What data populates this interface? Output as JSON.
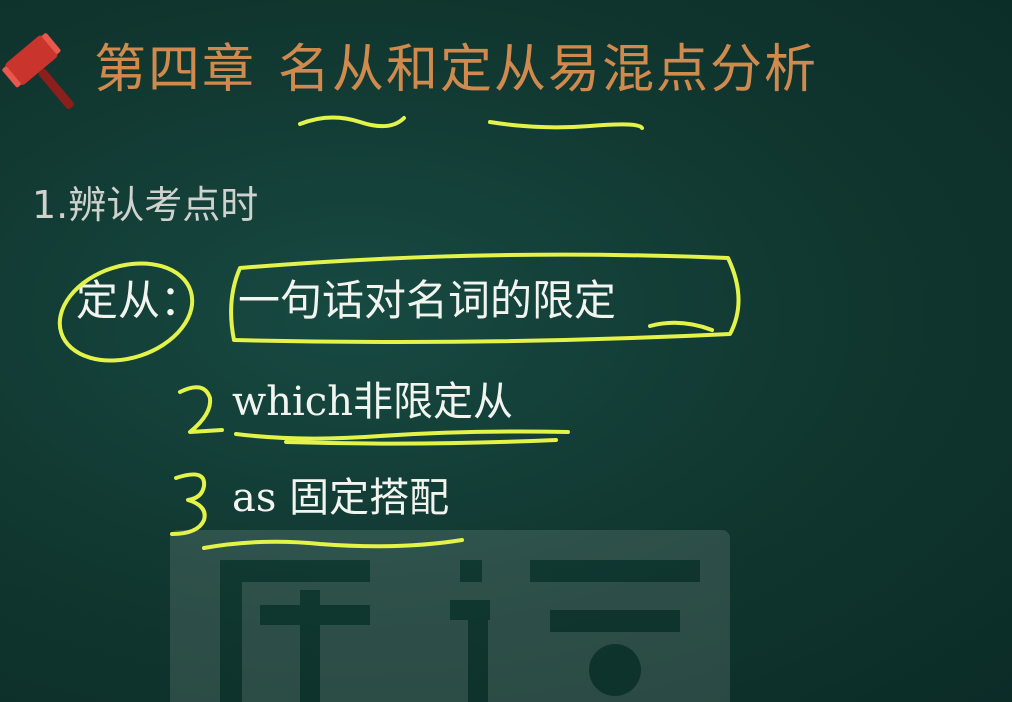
{
  "slide": {
    "chapter_number": "第四章",
    "chapter_title": "名从和定从易混点分析",
    "section_heading": "1.辨认考点时",
    "definition": {
      "term": "定从：",
      "text": "一句话对名词的限定"
    },
    "items": [
      {
        "marker": "2",
        "latin": "which",
        "text": "非限定从"
      },
      {
        "marker": "3",
        "latin": "as",
        "text": " 固定搭配"
      }
    ]
  },
  "colors": {
    "board": "#10362f",
    "title": "#d08a4e",
    "chalk": "#f2f4ef",
    "highlighter": "#e3f34a"
  },
  "icons": {
    "logo": "gavel-icon",
    "watermark": "brand-watermark"
  }
}
